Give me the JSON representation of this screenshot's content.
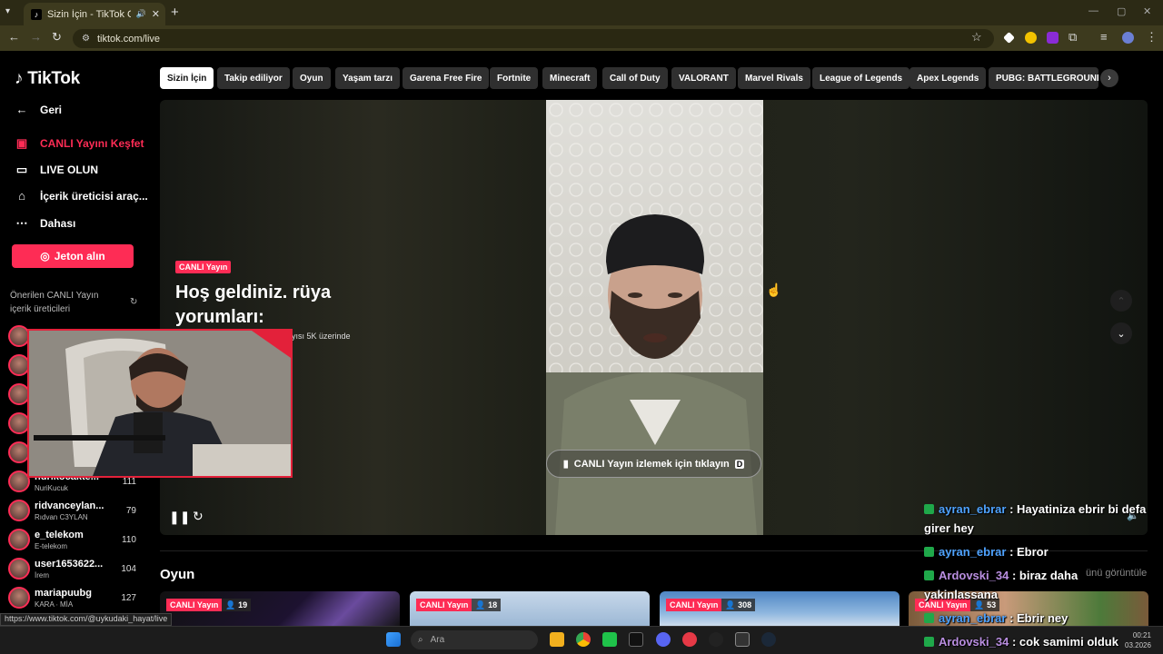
{
  "browser": {
    "tab_title": "Sizin İçin - TikTok CANLI Yayın",
    "url": "tiktok.com/live"
  },
  "sidebar": {
    "logo": "TikTok",
    "back": "Geri",
    "nav": [
      {
        "label": "CANLI Yayını Keşfet",
        "icon": "live-icon"
      },
      {
        "label": "LIVE OLUN",
        "icon": "video-camera-icon"
      },
      {
        "label": "İçerik üreticisi araç...",
        "icon": "creator-tools-icon"
      },
      {
        "label": "Dahası",
        "icon": "more-icon"
      }
    ],
    "coin_button": "Jeton alın",
    "suggested_title": "Önerilen CANLI Yayın içerik üreticileri",
    "creators": [
      {
        "name": "nurikocakte...",
        "sub": "NuriKucuk",
        "count": "111"
      },
      {
        "name": "ridvanceylan...",
        "sub": "Rıdvan C3YLAN",
        "count": "79"
      },
      {
        "name": "e_telekom",
        "sub": "E-telekom",
        "count": "110"
      },
      {
        "name": "user1653622...",
        "sub": "İrem",
        "count": "104"
      },
      {
        "name": "mariapuubg",
        "sub": "KARA ∙ MİA",
        "count": "127"
      }
    ]
  },
  "categories": [
    "Sizin İçin",
    "Takip ediliyor",
    "Oyun",
    "Yaşam tarzı",
    "Garena Free Fire",
    "Fortnite",
    "Minecraft",
    "Call of Duty",
    "VALORANT",
    "Marvel Rivals",
    "League of Legends",
    "Apex Legends",
    "PUBG: BATTLEGROUNDS"
  ],
  "player": {
    "badge": "CANLI Yayın",
    "title": "Hoş geldiniz. rüya yorumları:",
    "viewers_note": "ayısı 5K üzerinde",
    "watch_cta": "CANLI Yayın izlemek için tıklayın",
    "watch_key": "D"
  },
  "section": {
    "title": "Oyun",
    "cards": [
      {
        "badge": "CANLI Yayın",
        "viewers": "19"
      },
      {
        "badge": "CANLI Yayın",
        "viewers": "18"
      },
      {
        "badge": "CANLI Yayın",
        "viewers": "308"
      },
      {
        "badge": "CANLI Yayın",
        "viewers": "53"
      }
    ],
    "hidden_note": "ünü görüntüle"
  },
  "chat": [
    {
      "user": "ayran_ebrar",
      "msg": "Hayatiniza ebrir bi defa girer hey",
      "color": "#4fa3ff"
    },
    {
      "user": "ayran_ebrar",
      "msg": "Ebror",
      "color": "#4fa3ff"
    },
    {
      "user": "Ardovski_34",
      "msg": "biraz daha yakinlassana",
      "color": "#b98ee0"
    },
    {
      "user": "ayran_ebrar",
      "msg": "Ebrir ney",
      "color": "#4fa3ff"
    },
    {
      "user": "Ardovski_34",
      "msg": "cok samimi olduk",
      "color": "#b98ee0"
    }
  ],
  "status_url": "https://www.tiktok.com/@uykudaki_hayat/live",
  "taskbar": {
    "search": "Ara",
    "time": "00:21",
    "date": "03.2026"
  },
  "colors": {
    "brand": "#fe2c55",
    "chrome": "#3d3a1e"
  }
}
